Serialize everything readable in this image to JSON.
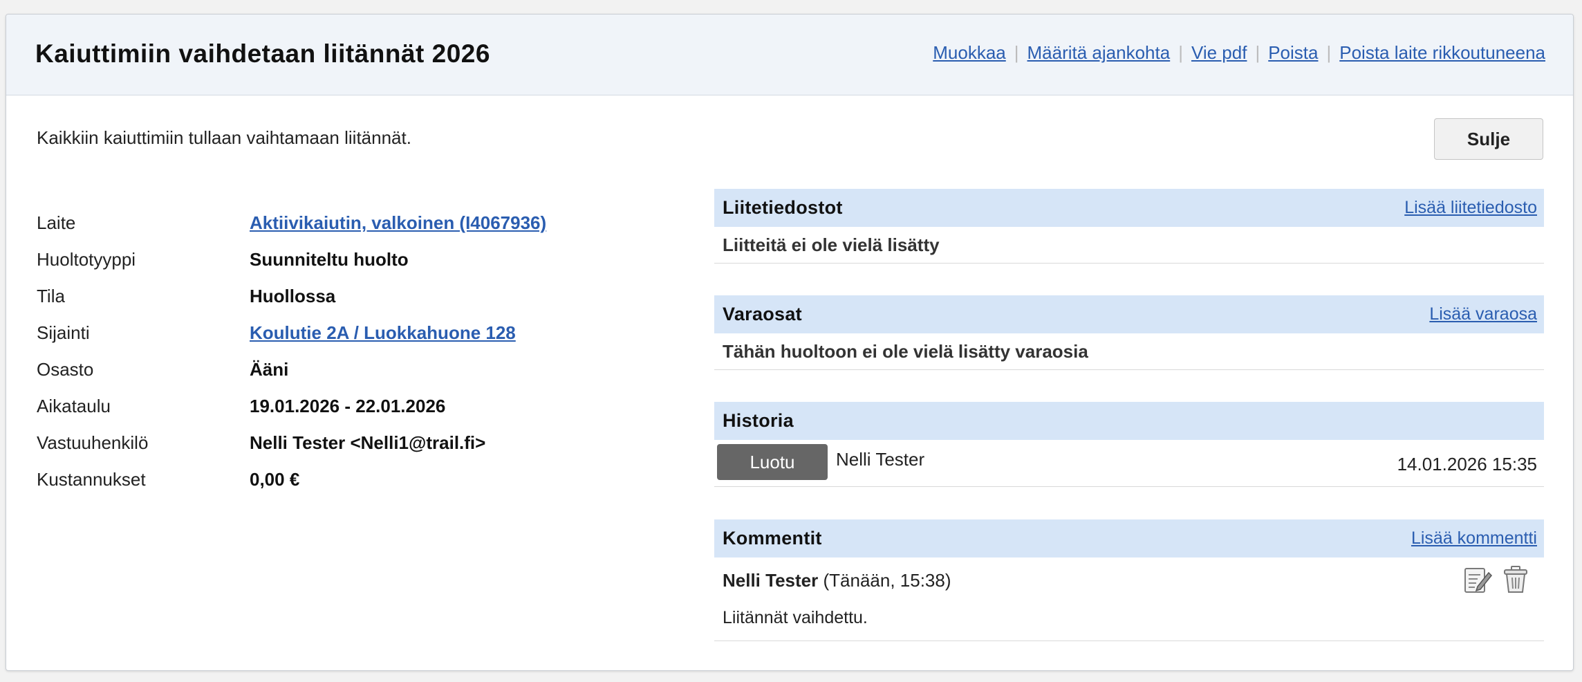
{
  "header": {
    "title": "Kaiuttimiin vaihdetaan liitännät 2026",
    "actions": {
      "edit": "Muokkaa",
      "schedule": "Määritä ajankohta",
      "export_pdf": "Vie pdf",
      "delete": "Poista",
      "delete_broken": "Poista laite rikkoutuneena"
    }
  },
  "description": "Kaikkiin kaiuttimiin tullaan vaihtamaan liitännät.",
  "close_label": "Sulje",
  "info": {
    "device": {
      "label": "Laite",
      "value": "Aktiivikaiutin, valkoinen (I4067936)"
    },
    "service_type": {
      "label": "Huoltotyyppi",
      "value": "Suunniteltu huolto"
    },
    "status": {
      "label": "Tila",
      "value": "Huollossa"
    },
    "location": {
      "label": "Sijainti",
      "value": "Koulutie 2A / Luokkahuone 128"
    },
    "department": {
      "label": "Osasto",
      "value": "Ääni"
    },
    "schedule": {
      "label": "Aikataulu",
      "value": "19.01.2026 - 22.01.2026"
    },
    "responsible": {
      "label": "Vastuuhenkilö",
      "value": "Nelli Tester <Nelli1@trail.fi>"
    },
    "costs": {
      "label": "Kustannukset",
      "value": "0,00 €"
    }
  },
  "attachments": {
    "title": "Liitetiedostot",
    "action": "Lisää liitetiedosto",
    "empty": "Liitteitä ei ole vielä lisätty"
  },
  "spare_parts": {
    "title": "Varaosat",
    "action": "Lisää varaosa",
    "empty": "Tähän huoltoon ei ole vielä lisätty varaosia"
  },
  "history": {
    "title": "Historia",
    "entries": [
      {
        "status": "Luotu",
        "user": "Nelli Tester",
        "time": "14.01.2026 15:35"
      }
    ]
  },
  "comments": {
    "title": "Kommentit",
    "action": "Lisää kommentti",
    "items": [
      {
        "author": "Nelli Tester",
        "time": "(Tänään, 15:38)",
        "text": "Liitännät vaihdettu."
      }
    ]
  },
  "icons": {
    "edit": "edit-note-icon",
    "delete": "trash-icon"
  },
  "colors": {
    "link": "#2a5db0",
    "section_header": "#d6e5f7",
    "badge": "#666666",
    "header_bg": "#f0f4f9"
  }
}
